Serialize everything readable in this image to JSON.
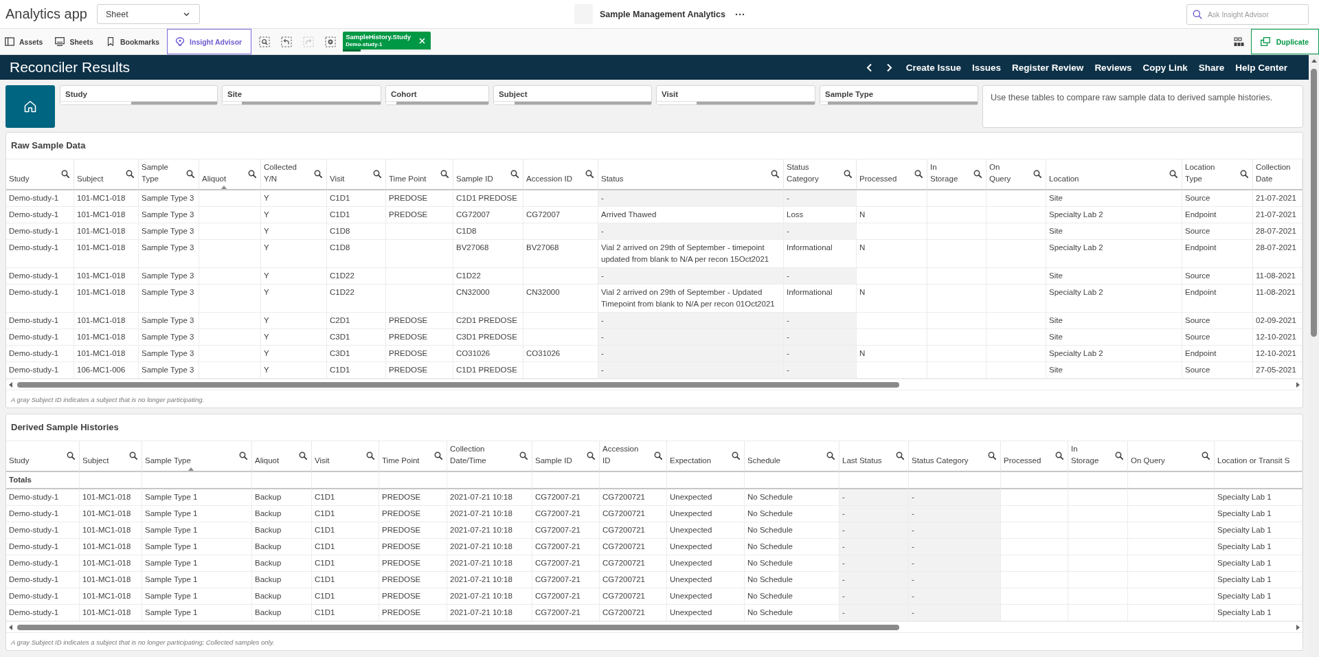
{
  "app_bar": {
    "title": "Analytics app",
    "sheet_dropdown": "Sheet",
    "sheet_title": "Sample Management Analytics",
    "search": {
      "placeholder": "Ask Insight Advisor"
    }
  },
  "toolbar": {
    "items": [
      {
        "kind": "assets",
        "label": "Assets"
      },
      {
        "kind": "sheets",
        "label": "Sheets"
      },
      {
        "kind": "bookmarks",
        "label": "Bookmarks"
      },
      {
        "kind": "advisor",
        "label": "Insight Advisor"
      }
    ],
    "tools": [
      {
        "kind": "search",
        "disabled": false
      },
      {
        "kind": "back",
        "disabled": false
      },
      {
        "kind": "forward",
        "disabled": true
      },
      {
        "kind": "clear",
        "disabled": false
      }
    ],
    "selection": {
      "field": "SampleHistory.Study",
      "value": "Demo-study-1",
      "level": 0.2
    },
    "duplicate": "Duplicate"
  },
  "header": {
    "title": "Reconciler Results",
    "links": [
      "Create Issue",
      "Issues",
      "Register Review",
      "Reviews",
      "Copy Link",
      "Share",
      "Help Center"
    ]
  },
  "filters": [
    {
      "label": "Study",
      "level": 0.55
    },
    {
      "label": "Site",
      "level": 0.88
    },
    {
      "label": "Cohort",
      "level": 0.9
    },
    {
      "label": "Subject",
      "level": 0.87
    },
    {
      "label": "Visit",
      "level": 0.75
    },
    {
      "label": "Sample Type",
      "level": 0.95
    }
  ],
  "info": "Use these tables to compare raw sample data to derived sample histories.",
  "raw_table": {
    "title": "Raw Sample Data",
    "columns": [
      {
        "label": "Study",
        "sorted": false
      },
      {
        "label": "Subject",
        "sorted": false
      },
      {
        "label": "Sample Type",
        "sorted": false
      },
      {
        "label": "Aliquot",
        "sorted": true
      },
      {
        "label": "Collected Y/N",
        "sorted": false
      },
      {
        "label": "Visit",
        "sorted": false
      },
      {
        "label": "Time Point",
        "sorted": false
      },
      {
        "label": "Sample ID",
        "sorted": false
      },
      {
        "label": "Accession ID",
        "sorted": false
      },
      {
        "label": "Status",
        "sorted": false
      },
      {
        "label": "Status Category",
        "sorted": false
      },
      {
        "label": "Processed",
        "sorted": false
      },
      {
        "label": "In Storage",
        "sorted": false
      },
      {
        "label": "On Query",
        "sorted": false
      },
      {
        "label": "Location",
        "sorted": false
      },
      {
        "label": "Location Type",
        "sorted": false
      },
      {
        "label": "Collection Date",
        "sorted": false
      }
    ],
    "rows": [
      {
        "cells": [
          "Demo-study-1",
          "101-MC1-018",
          "Sample Type 3",
          null,
          "Y",
          "C1D1",
          "PREDOSE",
          "C1D1 PREDOSE",
          null,
          "-",
          "-",
          null,
          null,
          null,
          "Site",
          "Source",
          "21-07-2021"
        ],
        "status_null": true
      },
      {
        "cells": [
          "Demo-study-1",
          "101-MC1-018",
          "Sample Type 3",
          null,
          "Y",
          "C1D1",
          "PREDOSE",
          "CG72007",
          "CG72007",
          "Arrived Thawed",
          "Loss",
          "N",
          null,
          null,
          "Specialty Lab 2",
          "Endpoint",
          "21-07-2021"
        ],
        "status_null": false
      },
      {
        "cells": [
          "Demo-study-1",
          "101-MC1-018",
          "Sample Type 3",
          null,
          "Y",
          "C1D8",
          null,
          "C1D8",
          null,
          "-",
          "-",
          null,
          null,
          null,
          "Site",
          "Source",
          "28-07-2021"
        ],
        "status_null": true
      },
      {
        "cells": [
          "Demo-study-1",
          "101-MC1-018",
          "Sample Type 3",
          null,
          "Y",
          "C1D8",
          null,
          "BV27068",
          "BV27068",
          "Vial 2 arrived on 29th of September - timepoint updated from blank to N/A per recon 15Oct2021",
          "Informational",
          "N",
          null,
          null,
          "Specialty Lab 2",
          "Endpoint",
          "28-07-2021"
        ],
        "status_null": false
      },
      {
        "cells": [
          "Demo-study-1",
          "101-MC1-018",
          "Sample Type 3",
          null,
          "Y",
          "C1D22",
          null,
          "C1D22",
          null,
          "-",
          "-",
          null,
          null,
          null,
          "Site",
          "Source",
          "11-08-2021"
        ],
        "status_null": true
      },
      {
        "cells": [
          "Demo-study-1",
          "101-MC1-018",
          "Sample Type 3",
          null,
          "Y",
          "C1D22",
          null,
          "CN32000",
          "CN32000",
          "Vial 2 arrived on 29th of September - Updated Timepoint from blank to N/A per recon 01Oct2021",
          "Informational",
          "N",
          null,
          null,
          "Specialty Lab 2",
          "Endpoint",
          "11-08-2021"
        ],
        "status_null": false
      },
      {
        "cells": [
          "Demo-study-1",
          "101-MC1-018",
          "Sample Type 3",
          null,
          "Y",
          "C2D1",
          "PREDOSE",
          "C2D1 PREDOSE",
          null,
          "-",
          "-",
          null,
          null,
          null,
          "Site",
          "Source",
          "02-09-2021"
        ],
        "status_null": true
      },
      {
        "cells": [
          "Demo-study-1",
          "101-MC1-018",
          "Sample Type 3",
          null,
          "Y",
          "C3D1",
          "PREDOSE",
          "C3D1 PREDOSE",
          null,
          "-",
          "-",
          null,
          null,
          null,
          "Site",
          "Source",
          "12-10-2021"
        ],
        "status_null": true
      },
      {
        "cells": [
          "Demo-study-1",
          "101-MC1-018",
          "Sample Type 3",
          null,
          "Y",
          "C3D1",
          "PREDOSE",
          "CO31026",
          "CO31026",
          "-",
          "-",
          "N",
          null,
          null,
          "Specialty Lab 2",
          "Endpoint",
          "12-10-2021"
        ],
        "status_null": true
      },
      {
        "cells": [
          "Demo-study-1",
          "106-MC1-006",
          "Sample Type 3",
          null,
          "Y",
          "C1D1",
          "PREDOSE",
          "C1D1 PREDOSE",
          null,
          "-",
          "-",
          null,
          null,
          null,
          "Site",
          "Source",
          "27-05-2021"
        ],
        "status_null": true
      }
    ],
    "footnote": "A gray Subject ID indicates a subject that is no longer participating."
  },
  "derived_table": {
    "title": "Derived Sample Histories",
    "columns": [
      {
        "label": "Study",
        "sorted": false
      },
      {
        "label": "Subject",
        "sorted": false
      },
      {
        "label": "Sample Type",
        "sorted": true
      },
      {
        "label": "Aliquot",
        "sorted": false
      },
      {
        "label": "Visit",
        "sorted": false
      },
      {
        "label": "Time Point",
        "sorted": false
      },
      {
        "label": "Collection Date/Time",
        "sorted": false
      },
      {
        "label": "Sample ID",
        "sorted": false
      },
      {
        "label": "Accession ID",
        "sorted": false
      },
      {
        "label": "Expectation",
        "sorted": false
      },
      {
        "label": "Schedule",
        "sorted": false
      },
      {
        "label": "Last Status",
        "sorted": false
      },
      {
        "label": "Status Category",
        "sorted": false
      },
      {
        "label": "Processed",
        "sorted": false
      },
      {
        "label": "In Storage",
        "sorted": false
      },
      {
        "label": "On Query",
        "sorted": false
      },
      {
        "label": "Location or Transit S",
        "sorted": false
      }
    ],
    "totals_label": "Totals",
    "rows": [
      {
        "cells": [
          "Demo-study-1",
          "101-MC1-018",
          "Sample Type 1",
          "Backup",
          "C1D1",
          "PREDOSE",
          "2021-07-21 10:18",
          "CG72007-21",
          "CG7200721",
          "Unexpected",
          "No Schedule",
          "-",
          "-",
          null,
          null,
          null,
          "Specialty Lab 1"
        ],
        "status_null": true
      },
      {
        "cells": [
          "Demo-study-1",
          "101-MC1-018",
          "Sample Type 1",
          "Backup",
          "C1D1",
          "PREDOSE",
          "2021-07-21 10:18",
          "CG72007-21",
          "CG7200721",
          "Unexpected",
          "No Schedule",
          "-",
          "-",
          null,
          null,
          null,
          "Specialty Lab 1"
        ],
        "status_null": true
      },
      {
        "cells": [
          "Demo-study-1",
          "101-MC1-018",
          "Sample Type 1",
          "Backup",
          "C1D1",
          "PREDOSE",
          "2021-07-21 10:18",
          "CG72007-21",
          "CG7200721",
          "Unexpected",
          "No Schedule",
          "-",
          "-",
          null,
          null,
          null,
          "Specialty Lab 1"
        ],
        "status_null": true
      },
      {
        "cells": [
          "Demo-study-1",
          "101-MC1-018",
          "Sample Type 1",
          "Backup",
          "C1D1",
          "PREDOSE",
          "2021-07-21 10:18",
          "CG72007-21",
          "CG7200721",
          "Unexpected",
          "No Schedule",
          "-",
          "-",
          null,
          null,
          null,
          "Specialty Lab 1"
        ],
        "status_null": true
      },
      {
        "cells": [
          "Demo-study-1",
          "101-MC1-018",
          "Sample Type 1",
          "Backup",
          "C1D1",
          "PREDOSE",
          "2021-07-21 10:18",
          "CG72007-21",
          "CG7200721",
          "Unexpected",
          "No Schedule",
          "-",
          "-",
          null,
          null,
          null,
          "Specialty Lab 1"
        ],
        "status_null": true
      },
      {
        "cells": [
          "Demo-study-1",
          "101-MC1-018",
          "Sample Type 1",
          "Backup",
          "C1D1",
          "PREDOSE",
          "2021-07-21 10:18",
          "CG72007-21",
          "CG7200721",
          "Unexpected",
          "No Schedule",
          "-",
          "-",
          null,
          null,
          null,
          "Specialty Lab 1"
        ],
        "status_null": true
      },
      {
        "cells": [
          "Demo-study-1",
          "101-MC1-018",
          "Sample Type 1",
          "Backup",
          "C1D1",
          "PREDOSE",
          "2021-07-21 10:18",
          "CG72007-21",
          "CG7200721",
          "Unexpected",
          "No Schedule",
          "-",
          "-",
          null,
          null,
          null,
          "Specialty Lab 1"
        ],
        "status_null": true
      },
      {
        "cells": [
          "Demo-study-1",
          "101-MC1-018",
          "Sample Type 1",
          "Backup",
          "C1D1",
          "PREDOSE",
          "2021-07-21 10:18",
          "CG72007-21",
          "CG7200721",
          "Unexpected",
          "No Schedule",
          "-",
          "-",
          null,
          null,
          null,
          "Specialty Lab 1"
        ],
        "status_null": true
      }
    ],
    "footnote": "A gray Subject ID indicates a subject that is no longer participating; Collected samples only."
  }
}
